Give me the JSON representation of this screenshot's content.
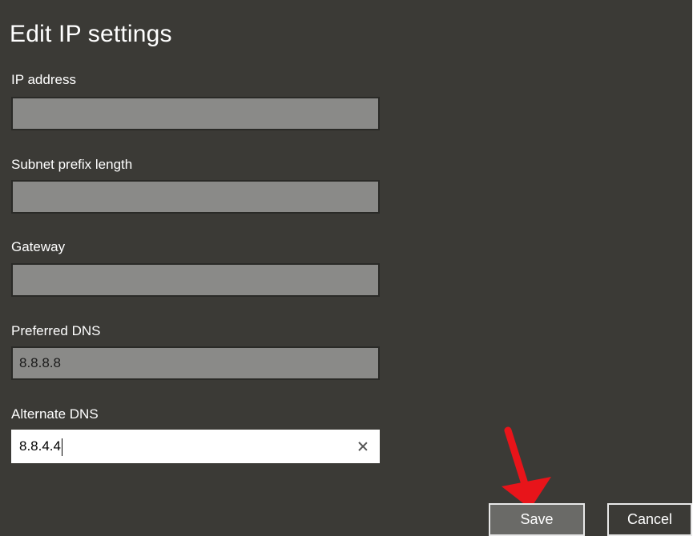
{
  "dialog": {
    "title": "Edit IP settings",
    "fields": [
      {
        "label": "IP address",
        "value": ""
      },
      {
        "label": "Subnet prefix length",
        "value": ""
      },
      {
        "label": "Gateway",
        "value": ""
      },
      {
        "label": "Preferred DNS",
        "value": "8.8.8.8"
      },
      {
        "label": "Alternate DNS",
        "value": "8.8.4.4"
      }
    ],
    "save_label": "Save",
    "cancel_label": "Cancel"
  },
  "icons": {
    "clear": "close-icon",
    "annotation": "red-arrow-icon"
  },
  "colors": {
    "background": "#3b3a36",
    "field_disabled": "#8a8a88",
    "annotation": "#e8141a"
  }
}
